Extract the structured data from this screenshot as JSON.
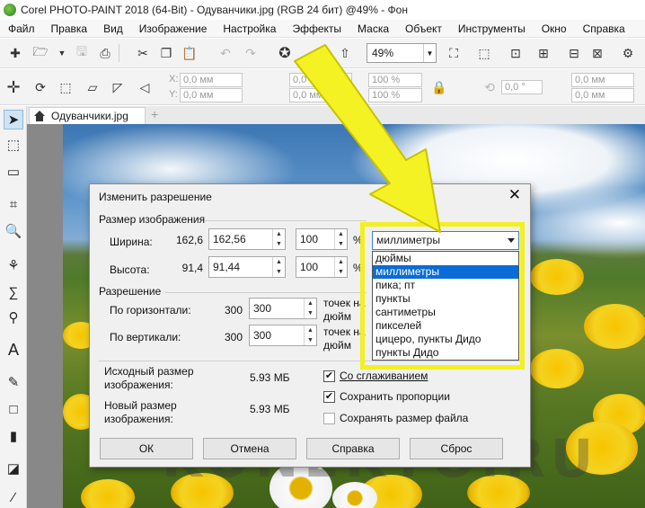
{
  "window": {
    "title": "Corel PHOTO-PAINT 2018 (64-Bit) - Одуванчики.jpg (RGB 24 бит) @49% - Фон"
  },
  "menu": [
    "Файл",
    "Правка",
    "Вид",
    "Изображение",
    "Настройка",
    "Эффекты",
    "Маска",
    "Объект",
    "Инструменты",
    "Окно",
    "Справка"
  ],
  "toolbar": {
    "zoom": "49%"
  },
  "propertybar": {
    "x_label": "X:",
    "x_value": "0,0 мм",
    "y_label": "Y:",
    "y_value": "0,0 мм",
    "w_value": "0,0 мм",
    "h_value": "0,0 мм",
    "pct1": "100 %",
    "pct2": "100 %",
    "angle": "0,0 °",
    "r1": "0,0 мм",
    "r2": "0,0 мм"
  },
  "document": {
    "tab_label": "Одуванчики.jpg"
  },
  "dialog": {
    "title": "Изменить разрешение",
    "size_group": "Размер изображения",
    "width_label": "Ширина:",
    "width_orig": "162,6",
    "width_value": "162,56",
    "width_pct": "100",
    "height_label": "Высота:",
    "height_orig": "91,4",
    "height_value": "91,44",
    "height_pct": "100",
    "pct_suffix": "%",
    "resolution_group": "Разрешение",
    "horiz_label": "По горизонтали:",
    "horiz_orig": "300",
    "horiz_value": "300",
    "vert_label": "По вертикали:",
    "vert_orig": "300",
    "vert_value": "300",
    "dpi_unit_line1": "точек на",
    "dpi_unit_line2": "дюйм",
    "orig_size_label": "Исходный размер изображения:",
    "orig_size_value": "5.93 МБ",
    "new_size_label": "Новый размер изображения:",
    "new_size_value": "5.93 МБ",
    "antialias": "Со сглаживанием",
    "keep_ratio": "Сохранить пропорции",
    "keep_filesize": "Сохранять размер файла",
    "ok": "ОК",
    "cancel": "Отмена",
    "help": "Справка",
    "reset": "Сброс",
    "units_selected": "миллиметры",
    "units_options": [
      "дюймы",
      "миллиметры",
      "пика; пт",
      "пункты",
      "сантиметры",
      "пикселей",
      "цицеро, пункты Дидо",
      "пункты Дидо"
    ]
  },
  "watermark": "KONEKTO.RU",
  "colors": {
    "highlight": "#f2f021",
    "selection": "#0a6cd6"
  }
}
